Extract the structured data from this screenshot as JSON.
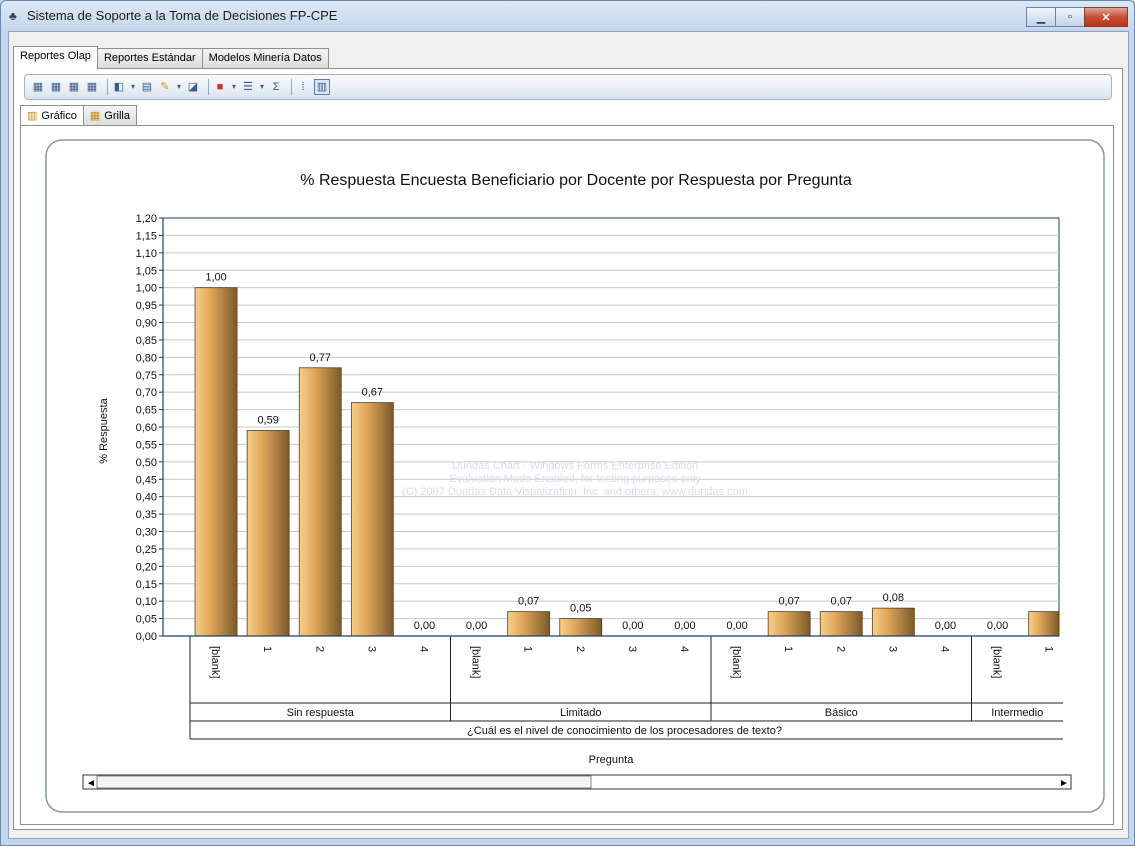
{
  "window": {
    "title": "Sistema de Soporte a la Toma de Decisiones FP-CPE",
    "controls": {
      "minimize": "▁",
      "maximize": "▫",
      "close": "✕"
    }
  },
  "tabs_top": [
    {
      "label": "Reportes Olap",
      "active": true
    },
    {
      "label": "Reportes Estándar",
      "active": false
    },
    {
      "label": "Modelos Minería Datos",
      "active": false
    }
  ],
  "toolbar": {
    "icons": [
      "cube-icon",
      "cube-icon",
      "cube-icon",
      "cube-icon",
      "chart-type-icon",
      "grid-icon",
      "pen-icon",
      "chart-wizard-icon",
      "palette-icon",
      "layout-icon",
      "sum-icon",
      "data-labels-icon",
      "chart-view-icon"
    ]
  },
  "subtabs": [
    {
      "label": "Gráfico",
      "active": true
    },
    {
      "label": "Grilla",
      "active": false
    }
  ],
  "chart_data": {
    "type": "bar",
    "title": "% Respuesta Encuesta Beneficiario por Docente por Respuesta por Pregunta",
    "ylabel": "% Respuesta",
    "xlabel": "Pregunta",
    "ylim": [
      0,
      1.2
    ],
    "yticks": [
      "0,00",
      "0,05",
      "0,10",
      "0,15",
      "0,20",
      "0,25",
      "0,30",
      "0,35",
      "0,40",
      "0,45",
      "0,50",
      "0,55",
      "0,60",
      "0,65",
      "0,70",
      "0,75",
      "0,80",
      "0,85",
      "0,90",
      "0,95",
      "1,00",
      "1,05",
      "1,10",
      "1,15",
      "1,20"
    ],
    "bar_color": "#e2a85a",
    "groups": [
      {
        "name": "Sin respuesta",
        "categories": [
          "[blank]",
          "1",
          "2",
          "3",
          "4"
        ],
        "values": [
          1.0,
          0.59,
          0.77,
          0.67,
          0.0
        ],
        "labels": [
          "1,00",
          "0,59",
          "0,77",
          "0,67",
          "0,00"
        ]
      },
      {
        "name": "Limitado",
        "categories": [
          "[blank]",
          "1",
          "2",
          "3",
          "4"
        ],
        "values": [
          0.0,
          0.07,
          0.05,
          0.0,
          0.0
        ],
        "labels": [
          "0,00",
          "0,07",
          "0,05",
          "0,00",
          "0,00"
        ]
      },
      {
        "name": "Básico",
        "categories": [
          "[blank]",
          "1",
          "2",
          "3",
          "4"
        ],
        "values": [
          0.0,
          0.07,
          0.07,
          0.08,
          0.0
        ],
        "labels": [
          "0,00",
          "0,07",
          "0,07",
          "0,08",
          "0,00"
        ]
      },
      {
        "name": "Intermedio",
        "categories": [
          "[blank]",
          "1"
        ],
        "values": [
          0.0,
          0.07
        ],
        "labels": [
          "0,00",
          ""
        ]
      }
    ],
    "outer_group": "¿Cuál es el nivel de conocimiento de los procesadores de texto?",
    "watermark": [
      "Dundas Chart - Windows Forms Enterprise Edition",
      "Evaluation Mode Enabled, for testing purposes only",
      "(C) 2007 Dundas Data Visualization, Inc. and others, www.dundas.com"
    ],
    "grid": true
  }
}
